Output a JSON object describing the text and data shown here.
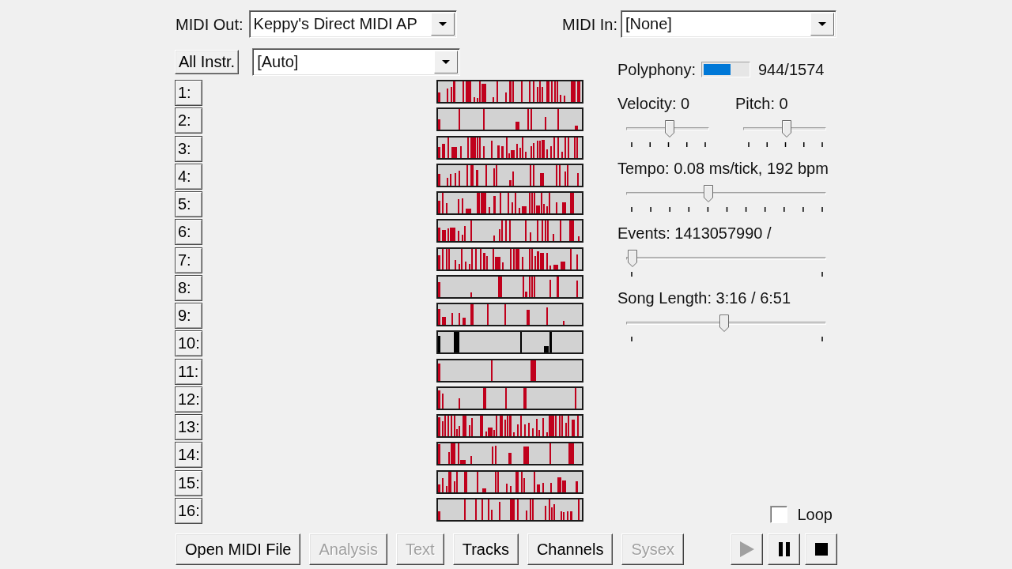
{
  "midi_out": {
    "label": "MIDI Out:",
    "value": "Keppy's Direct MIDI AP"
  },
  "midi_in": {
    "label": "MIDI In:",
    "value": "[None]"
  },
  "instrument": {
    "button": "All Instr.",
    "value": "[Auto]"
  },
  "channels": [
    {
      "label": "1:",
      "color": "#c0001c"
    },
    {
      "label": "2:",
      "color": "#c0001c"
    },
    {
      "label": "3:",
      "color": "#c0001c"
    },
    {
      "label": "4:",
      "color": "#c0001c"
    },
    {
      "label": "5:",
      "color": "#c0001c"
    },
    {
      "label": "6:",
      "color": "#c0001c"
    },
    {
      "label": "7:",
      "color": "#c0001c"
    },
    {
      "label": "8:",
      "color": "#c0001c"
    },
    {
      "label": "9:",
      "color": "#c0001c"
    },
    {
      "label": "10:",
      "color": "#000000"
    },
    {
      "label": "11:",
      "color": "#c0001c"
    },
    {
      "label": "12:",
      "color": "#c0001c"
    },
    {
      "label": "13:",
      "color": "#c0001c"
    },
    {
      "label": "14:",
      "color": "#c0001c"
    },
    {
      "label": "15:",
      "color": "#c0001c"
    },
    {
      "label": "16:",
      "color": "#c0001c"
    }
  ],
  "polyphony": {
    "label": "Polyphony:",
    "level": 0.6,
    "reading": "944/1574"
  },
  "velocity": {
    "label": "Velocity: 0",
    "level": 0.5
  },
  "pitch": {
    "label": "Pitch: 0",
    "level": 0.5
  },
  "tempo": {
    "label": "Tempo: 0.08 ms/tick, 192 bpm",
    "level": 0.4
  },
  "events": {
    "label": "Events: 1413057990 /",
    "level": 0
  },
  "song_length": {
    "label": "Song Length: 3:16 / 6:51",
    "level": 0.48
  },
  "loop": {
    "label": "Loop",
    "checked": false
  },
  "buttons": [
    {
      "label": "Open MIDI File",
      "disabled": false
    },
    {
      "label": "Analysis",
      "disabled": true
    },
    {
      "label": "Text",
      "disabled": true
    },
    {
      "label": "Tracks",
      "disabled": false
    },
    {
      "label": "Channels",
      "disabled": false
    },
    {
      "label": "Sysex",
      "disabled": true
    }
  ],
  "transport": [
    {
      "kind": "play",
      "disabled": true
    },
    {
      "kind": "pause",
      "disabled": false
    },
    {
      "kind": "stop",
      "disabled": false
    }
  ]
}
